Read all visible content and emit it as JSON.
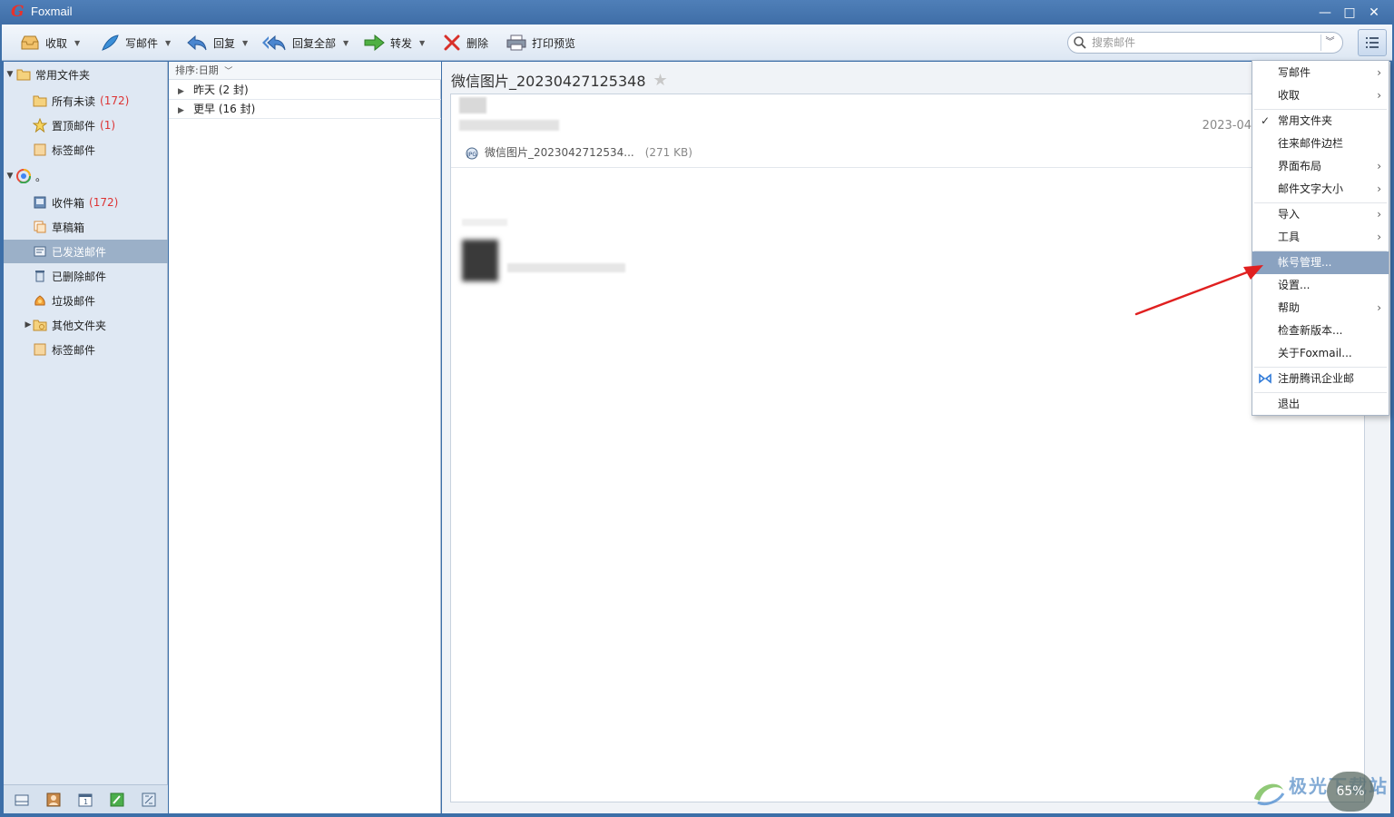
{
  "window": {
    "app_title": "Foxmail",
    "logo_glyph": "G",
    "minimize_glyph": "—",
    "maximize_glyph": "□",
    "close_glyph": "✕"
  },
  "toolbar": {
    "receive": "收取",
    "compose": "写邮件",
    "reply": "回复",
    "reply_all": "回复全部",
    "forward": "转发",
    "delete": "删除",
    "print_preview": "打印预览",
    "search_placeholder": "搜索邮件"
  },
  "sidebar": {
    "favorites_label": "常用文件夹",
    "favorites": [
      {
        "label": "所有未读",
        "count": "(172)"
      },
      {
        "label": "置顶邮件",
        "count": "(1)"
      },
      {
        "label": "标签邮件",
        "count": ""
      }
    ],
    "account_label": "。",
    "account_folders": [
      {
        "label": "收件箱",
        "count": "(172)"
      },
      {
        "label": "草稿箱",
        "count": ""
      },
      {
        "label": "已发送邮件",
        "count": ""
      },
      {
        "label": "已删除邮件",
        "count": ""
      },
      {
        "label": "垃圾邮件",
        "count": ""
      },
      {
        "label": "其他文件夹",
        "count": ""
      },
      {
        "label": "标签邮件",
        "count": ""
      }
    ],
    "selected": "已发送邮件"
  },
  "message_list": {
    "sort_label": "排序:日期",
    "groups": [
      {
        "label": "昨天 (2 封)"
      },
      {
        "label": "更早 (16 封)"
      }
    ]
  },
  "reader": {
    "subject": "微信图片_20230427125348",
    "date": "2023-04",
    "attachment_name": "微信图片_2023042712534...",
    "attachment_size": "(271 KB)"
  },
  "menu": {
    "items": [
      {
        "label": "写邮件",
        "submenu": true
      },
      {
        "label": "收取",
        "submenu": true
      },
      {
        "label": "常用文件夹",
        "checked": true
      },
      {
        "label": "往来邮件边栏"
      },
      {
        "label": "界面布局",
        "submenu": true
      },
      {
        "label": "邮件文字大小",
        "submenu": true
      },
      {
        "label": "导入",
        "submenu": true
      },
      {
        "label": "工具",
        "submenu": true
      },
      {
        "label": "帐号管理...",
        "highlighted": true
      },
      {
        "label": "设置..."
      },
      {
        "label": "帮助",
        "submenu": true
      },
      {
        "label": "检查新版本..."
      },
      {
        "label": "关于Foxmail..."
      },
      {
        "label": "注册腾讯企业邮"
      },
      {
        "label": "退出"
      }
    ],
    "submenu_glyph": "›",
    "check_glyph": "✓"
  },
  "watermark": {
    "text": "极光下载站",
    "badge": "65%"
  },
  "colors": {
    "accent": "#3f6ea7",
    "selected_folder": "#9bb0c8",
    "menu_highlight": "#8aa2c0",
    "unread_count": "#dd3333",
    "annotation_arrow": "#e02020"
  }
}
